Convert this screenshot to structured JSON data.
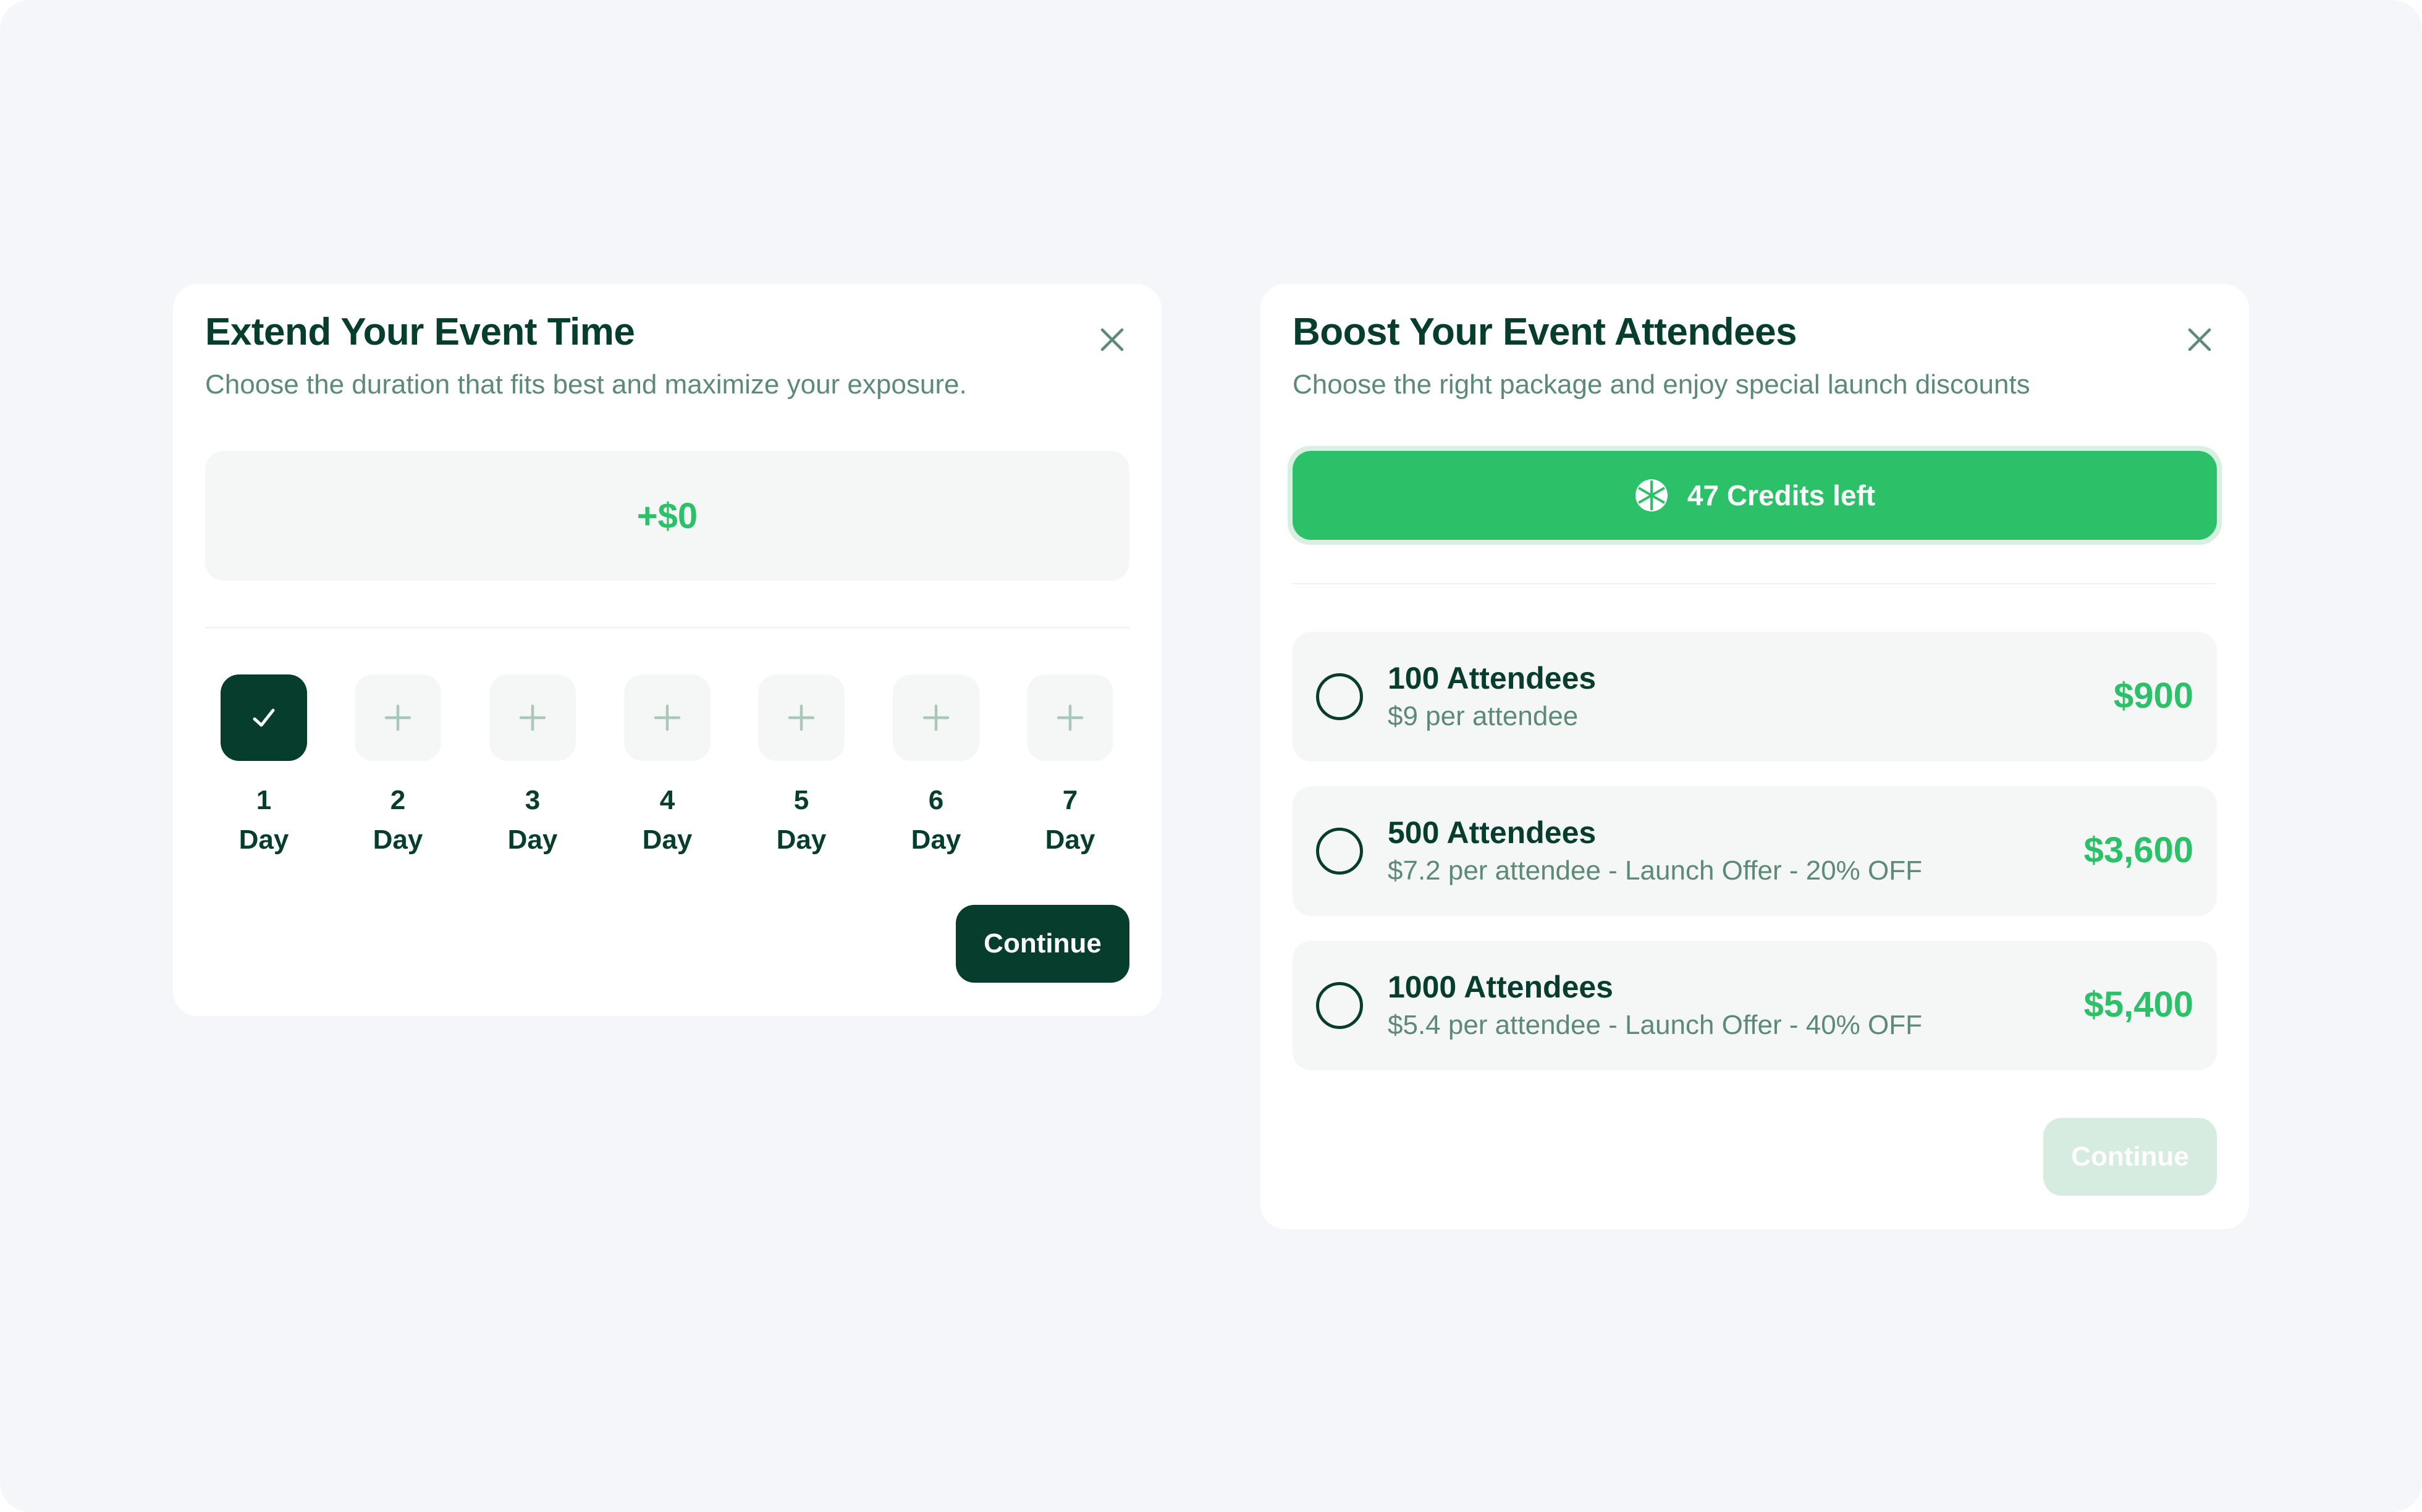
{
  "colors": {
    "primary_dark": "#073d2d",
    "accent_green": "#2cc068",
    "muted_text": "#5d8a78",
    "surface": "#f5f7f6",
    "disabled_button": "#d6ece0"
  },
  "extend_modal": {
    "title": "Extend Your Event Time",
    "subtitle": "Choose the duration that fits best and maximize your exposure.",
    "price": "+$0",
    "days": [
      {
        "number": "1",
        "unit": "Day",
        "selected": true,
        "icon": "check-icon"
      },
      {
        "number": "2",
        "unit": "Day",
        "selected": false,
        "icon": "plus-icon"
      },
      {
        "number": "3",
        "unit": "Day",
        "selected": false,
        "icon": "plus-icon"
      },
      {
        "number": "4",
        "unit": "Day",
        "selected": false,
        "icon": "plus-icon"
      },
      {
        "number": "5",
        "unit": "Day",
        "selected": false,
        "icon": "plus-icon"
      },
      {
        "number": "6",
        "unit": "Day",
        "selected": false,
        "icon": "plus-icon"
      },
      {
        "number": "7",
        "unit": "Day",
        "selected": false,
        "icon": "plus-icon"
      }
    ],
    "continue_label": "Continue",
    "continue_enabled": true
  },
  "boost_modal": {
    "title": "Boost Your Event Attendees",
    "subtitle": "Choose the right package and enjoy special launch discounts",
    "credits_label": "47 Credits left",
    "credits_icon": "credits-icon",
    "packages": [
      {
        "title": "100 Attendees",
        "description": "$9 per attendee",
        "price": "$900",
        "selected": false
      },
      {
        "title": "500 Attendees",
        "description": "$7.2 per attendee - Launch Offer - 20% OFF",
        "price": "$3,600",
        "selected": false
      },
      {
        "title": "1000 Attendees",
        "description": "$5.4 per attendee - Launch Offer - 40% OFF",
        "price": "$5,400",
        "selected": false
      }
    ],
    "continue_label": "Continue",
    "continue_enabled": false
  }
}
